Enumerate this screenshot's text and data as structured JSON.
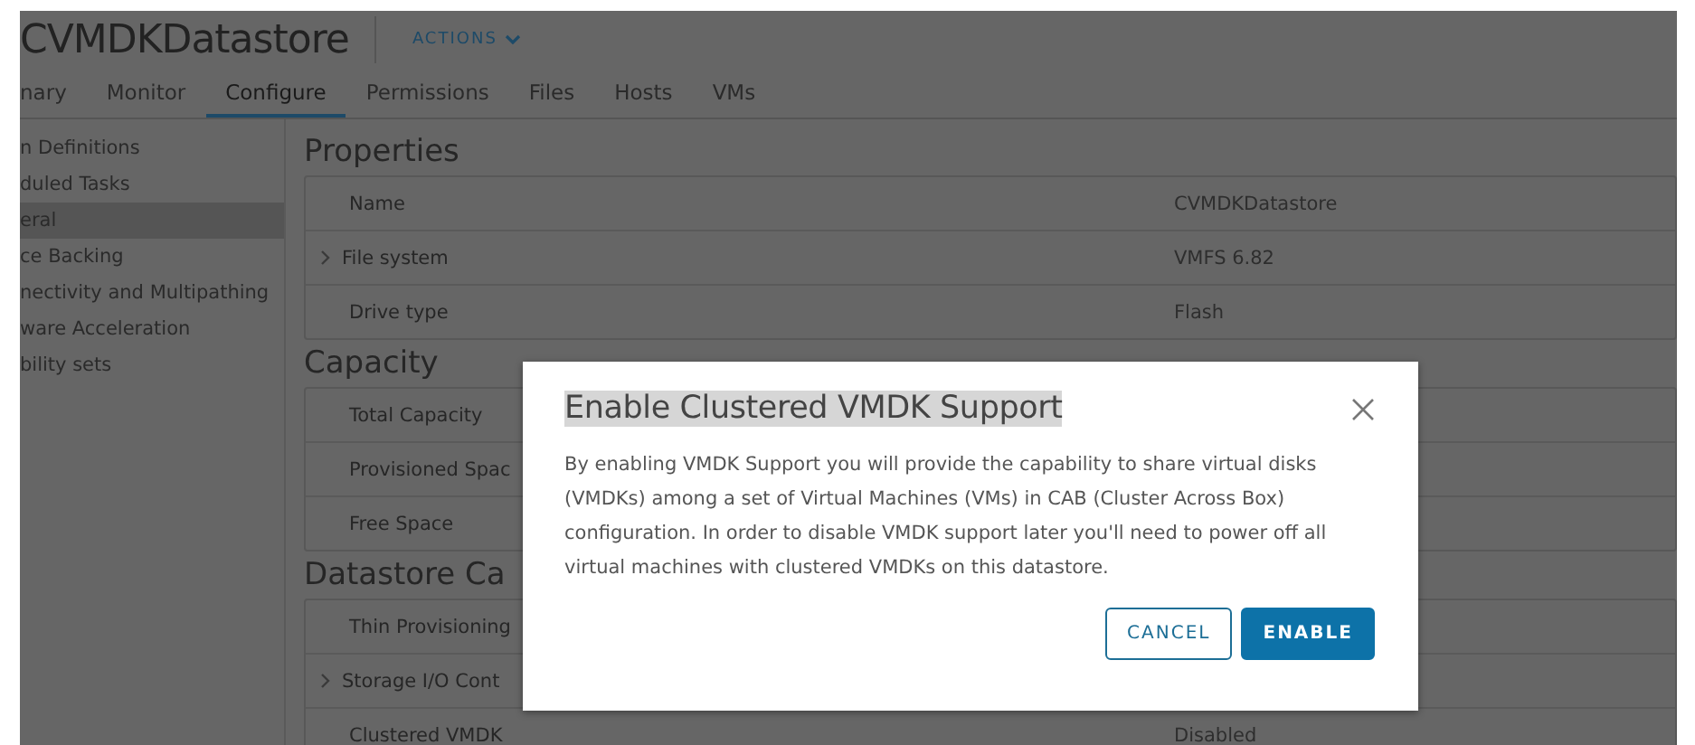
{
  "header": {
    "title": "CVMDKDatastore",
    "actions": "ACTIONS"
  },
  "tabs": [
    {
      "label": "nary",
      "selected": false
    },
    {
      "label": "Monitor",
      "selected": false
    },
    {
      "label": "Configure",
      "selected": true
    },
    {
      "label": "Permissions",
      "selected": false
    },
    {
      "label": "Files",
      "selected": false
    },
    {
      "label": "Hosts",
      "selected": false
    },
    {
      "label": "VMs",
      "selected": false
    }
  ],
  "sidebar": {
    "items": [
      {
        "label": "n Definitions",
        "selected": false
      },
      {
        "label": "duled Tasks",
        "selected": false
      },
      {
        "label": "eral",
        "selected": true
      },
      {
        "label": "ce Backing",
        "selected": false
      },
      {
        "label": "nectivity and Multipathing",
        "selected": false
      },
      {
        "label": "ware Acceleration",
        "selected": false
      },
      {
        "label": "bility sets",
        "selected": false
      }
    ]
  },
  "sections": [
    {
      "title": "Properties",
      "rows": [
        {
          "label": "Name",
          "value": "CVMDKDatastore",
          "expandable": false
        },
        {
          "label": "File system",
          "value": "VMFS 6.82",
          "expandable": true
        },
        {
          "label": "Drive type",
          "value": "Flash",
          "expandable": false
        }
      ]
    },
    {
      "title": "Capacity",
      "rows": [
        {
          "label": "Total Capacity",
          "expandable": false
        },
        {
          "label": "Provisioned Spac",
          "expandable": false
        },
        {
          "label": "Free Space",
          "expandable": false
        }
      ]
    },
    {
      "title": "Datastore Ca",
      "rows": [
        {
          "label": "Thin Provisioning",
          "expandable": false
        },
        {
          "label": "Storage I/O Cont",
          "expandable": true
        },
        {
          "label": "Clustered VMDK",
          "value": "Disabled",
          "expandable": false
        }
      ]
    }
  ],
  "dialog": {
    "title": "Enable Clustered VMDK Support",
    "body": "By enabling VMDK Support you will provide the capability to share virtual disks (VMDKs) among a set of Virtual Machines (VMs) in CAB (Cluster Across Box) configuration. In order to disable VMDK support later you'll need to power off all virtual machines with clustered VMDKs on this datastore.",
    "buttons": [
      {
        "label": "CANCEL",
        "kind": "secondary"
      },
      {
        "label": "ENABLE",
        "kind": "primary"
      }
    ]
  }
}
